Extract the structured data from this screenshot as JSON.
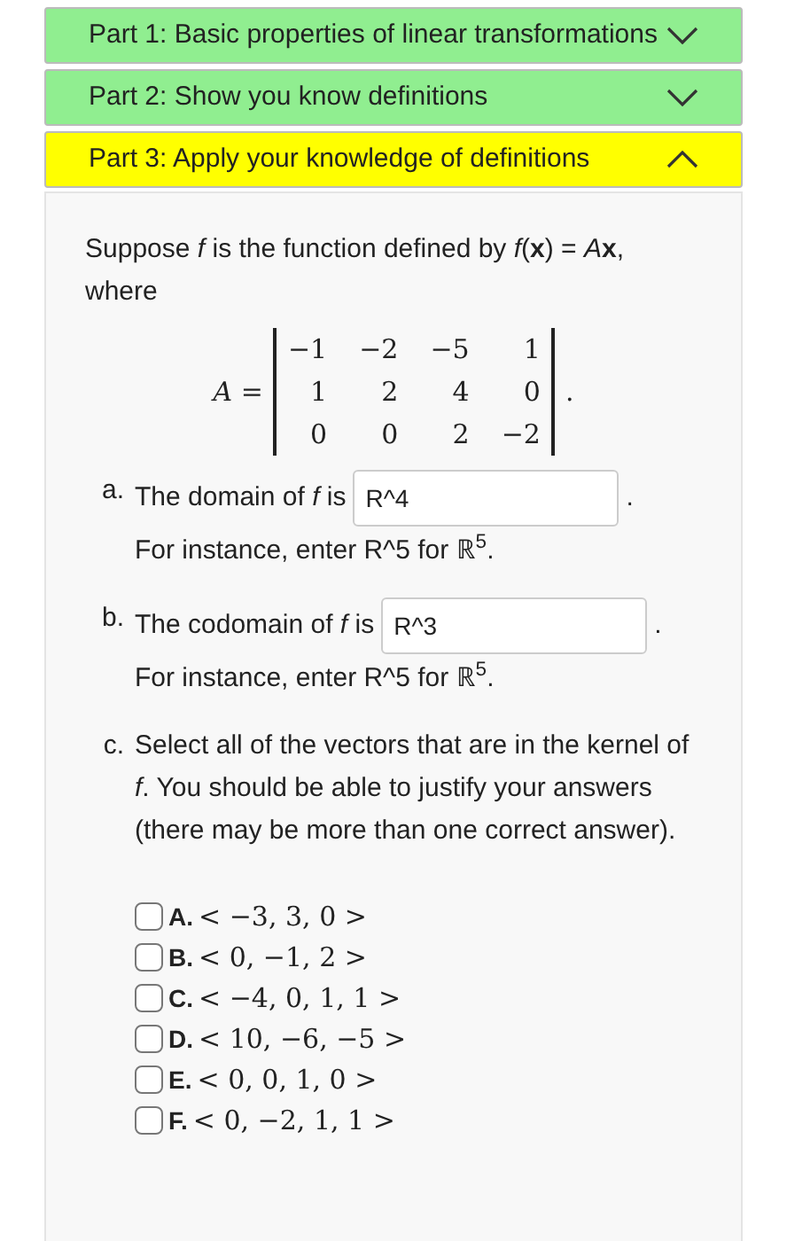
{
  "accordion": [
    {
      "title": "Part 1: Basic properties of linear transformations",
      "expanded": false,
      "color": "#90ee90"
    },
    {
      "title": "Part 2: Show you know definitions",
      "expanded": false,
      "color": "#90ee90"
    },
    {
      "title": "Part 3: Apply your knowledge of definitions",
      "expanded": true,
      "color": "#ffff00"
    }
  ],
  "intro": "Suppose *f* is the function defined by *f*(**x**) = *A*​**x**, where",
  "matrix": {
    "name": "A =",
    "rows": [
      [
        "−1",
        "−2",
        "−5",
        "1"
      ],
      [
        "1",
        "2",
        "4",
        "0"
      ],
      [
        "0",
        "0",
        "2",
        "−2"
      ]
    ],
    "end": "."
  },
  "questions": [
    {
      "kind": "input",
      "label": "a.",
      "prompt": "The domain of *f* is",
      "value": "R^4",
      "after": ".",
      "hint": "For instance, enter R^5 for ℝ$^{5}$."
    },
    {
      "kind": "input",
      "label": "b.",
      "prompt": "The codomain of *f* is",
      "value": "R^3",
      "after": ".",
      "hint": "For instance, enter R^5 for ℝ$^{5}$."
    },
    {
      "kind": "choices",
      "label": "c.",
      "prompt": "Select all of the vectors that are in the kernel of *f*. You should be able to justify your answers (there may be more than one correct answer).",
      "options": [
        {
          "letter": "A.",
          "vector": "< −3, 3, 0 >",
          "checked": false
        },
        {
          "letter": "B.",
          "vector": "< 0, −1, 2 >",
          "checked": false
        },
        {
          "letter": "C.",
          "vector": "< −4, 0, 1, 1 >",
          "checked": false
        },
        {
          "letter": "D.",
          "vector": "< 10, −6, −5 >",
          "checked": false
        },
        {
          "letter": "E.",
          "vector": "< 0, 0, 1, 0 >",
          "checked": false
        },
        {
          "letter": "F.",
          "vector": "< 0, −2, 1, 1 >",
          "checked": false
        }
      ]
    }
  ]
}
